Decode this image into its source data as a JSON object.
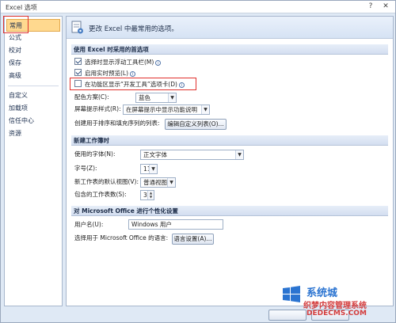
{
  "window": {
    "title": "Excel 选项",
    "help_icon": "help-icon",
    "close_icon": "close-icon"
  },
  "nav": {
    "items": [
      {
        "label": "常用",
        "active": true
      },
      {
        "label": "公式"
      },
      {
        "label": "校对"
      },
      {
        "label": "保存"
      },
      {
        "label": "高级"
      },
      {
        "label": "自定义"
      },
      {
        "label": "加载项"
      },
      {
        "label": "信任中心"
      },
      {
        "label": "资源"
      }
    ]
  },
  "header": {
    "text": "更改 Excel 中最常用的选项。"
  },
  "section1": {
    "title": "使用 Excel 时采用的首选项",
    "mini_toolbar": {
      "label": "选择时显示浮动工具栏(M)",
      "checked": true
    },
    "live_preview": {
      "label": "启用实时预览(L)",
      "checked": true
    },
    "developer_tab": {
      "label": "在功能区显示“开发工具”选项卡(D)",
      "checked": false
    },
    "color_scheme": {
      "label": "配色方案(C):",
      "value": "蓝色"
    },
    "screentip": {
      "label": "屏幕提示样式(R):",
      "value": "在屏幕提示中显示功能说明"
    },
    "custom_lists": {
      "label": "创建用于排序和填充序列的列表:",
      "button": "编辑自定义列表(O)..."
    }
  },
  "section2": {
    "title": "新建工作簿时",
    "font": {
      "label": "使用的字体(N):",
      "value": "正文字体"
    },
    "font_size": {
      "label": "字号(Z):",
      "value": "11"
    },
    "default_view": {
      "label": "新工作表的默认视图(V):",
      "value": "普通视图"
    },
    "sheets": {
      "label": "包含的工作表数(S):",
      "value": "3"
    }
  },
  "section3": {
    "title": "对 Microsoft Office 进行个性化设置",
    "username": {
      "label": "用户名(U):",
      "value": "Windows 用户"
    },
    "language": {
      "label": "选择用于 Microsoft Office 的语言:",
      "button": "语言设置(A)..."
    }
  },
  "watermark": {
    "line1": "系统城",
    "line2": "织梦内容管理系统",
    "line3": "DEDECMS.COM"
  },
  "colors": {
    "highlight": "#e0312d",
    "accent": "#ffd98f"
  }
}
